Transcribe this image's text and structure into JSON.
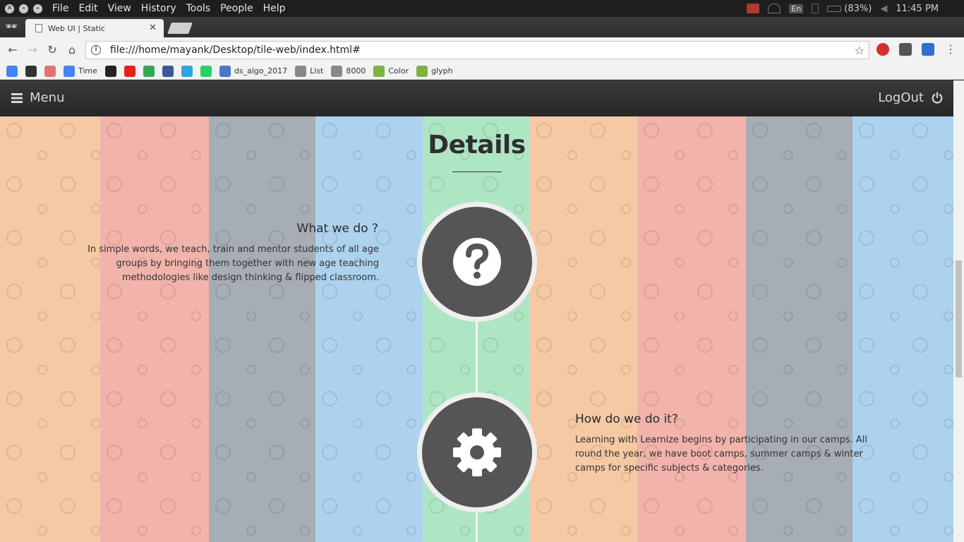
{
  "os": {
    "menus": [
      "File",
      "Edit",
      "View",
      "History",
      "Tools",
      "People",
      "Help"
    ],
    "keyboard_layout": "En",
    "battery": "(83%)",
    "clock": "11:45 PM"
  },
  "browser": {
    "tab_title": "Web UI | Static",
    "url": "file:///home/mayank/Desktop/tile-web/index.html#",
    "bookmarks": [
      {
        "label": "",
        "icon": "google-icon",
        "color": "#4285f4"
      },
      {
        "label": "",
        "icon": "bookmark-app-icon",
        "color": "#333333"
      },
      {
        "label": "",
        "icon": "backpack-icon",
        "color": "#e57373"
      },
      {
        "label": "Time",
        "icon": "google-icon",
        "color": "#4285f4"
      },
      {
        "label": "",
        "icon": "github-icon",
        "color": "#222222"
      },
      {
        "label": "",
        "icon": "youtube-icon",
        "color": "#e62117"
      },
      {
        "label": "",
        "icon": "drive-icon",
        "color": "#34a853"
      },
      {
        "label": "",
        "icon": "facebook-icon",
        "color": "#3b5998"
      },
      {
        "label": "",
        "icon": "telegram-icon",
        "color": "#2ca5e0"
      },
      {
        "label": "",
        "icon": "whatsapp-icon",
        "color": "#25d366"
      },
      {
        "label": "ds_algo_2017",
        "icon": "doc-icon",
        "color": "#4a77c6"
      },
      {
        "label": "List",
        "icon": "page-icon",
        "color": "#888888"
      },
      {
        "label": "8000",
        "icon": "page-icon",
        "color": "#888888"
      },
      {
        "label": "Color",
        "icon": "w3-icon",
        "color": "#7cb342"
      },
      {
        "label": "glyph",
        "icon": "w3-icon",
        "color": "#7cb342"
      }
    ]
  },
  "page": {
    "menu_label": "Menu",
    "logout_label": "LogOut",
    "section_title": "Details",
    "what": {
      "title": "What we do ?",
      "text": "In simple words, we teach, train and mentor students of all age groups by bringing them together with new age teaching methodologies like design thinking & flipped classroom.",
      "icon": "question-icon"
    },
    "how": {
      "title": "How do we do it?",
      "text": "Learning with Learnize begins by participating in our camps. All round the year, we have boot camps, summer camps & winter camps for specific subjects & categories.",
      "icon": "gear-icon"
    },
    "stripe_colors": [
      "#f4c9a3",
      "#f2b3ab",
      "#a6adb5",
      "#acd2ee",
      "#aee6c4",
      "#f4c9a3",
      "#f2b3ab",
      "#a6adb5",
      "#acd2ee"
    ],
    "navbar_color": "#2e2e2e",
    "circle_color": "#555555"
  }
}
